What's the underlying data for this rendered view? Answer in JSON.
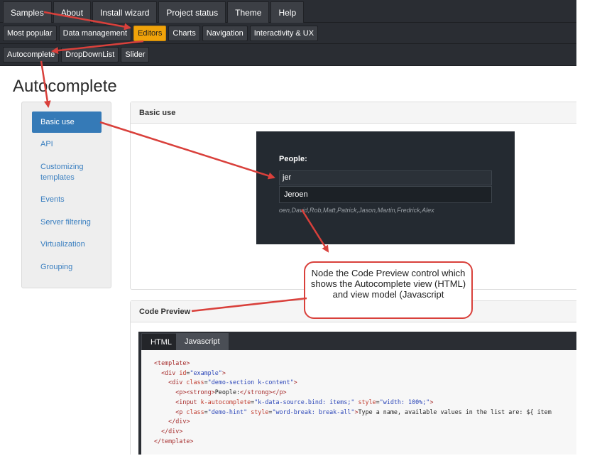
{
  "top_nav": [
    "Samples",
    "About",
    "Install wizard",
    "Project status",
    "Theme",
    "Help"
  ],
  "category_nav": [
    {
      "label": "Most popular",
      "active": false
    },
    {
      "label": "Data management",
      "active": false
    },
    {
      "label": "Editors",
      "active": true
    },
    {
      "label": "Charts",
      "active": false
    },
    {
      "label": "Navigation",
      "active": false
    },
    {
      "label": "Interactivity & UX",
      "active": false
    }
  ],
  "sub_nav": [
    "Autocomplete",
    "DropDownList",
    "Slider"
  ],
  "page_title": "Autocomplete",
  "sidebar": {
    "items": [
      {
        "label": "Basic use",
        "active": true
      },
      {
        "label": "API",
        "active": false
      },
      {
        "label": "Customizing templates",
        "active": false
      },
      {
        "label": "Events",
        "active": false
      },
      {
        "label": "Server filtering",
        "active": false
      },
      {
        "label": "Virtualization",
        "active": false
      },
      {
        "label": "Grouping",
        "active": false
      }
    ]
  },
  "basic_panel": {
    "title": "Basic use",
    "people_label": "People:",
    "input_value": "jer",
    "suggestion": "Jeroen",
    "hint": "oen,David,Rob,Matt,Patrick,Jason,Martin,Fredrick,Alex"
  },
  "code_panel": {
    "title": "Code Preview",
    "tabs": [
      "HTML",
      "Javascript"
    ],
    "active_tab": "HTML"
  },
  "callout_text": "Node the Code Preview control which shows the Autocomplete view (HTML) and view model (Javascript",
  "colors": {
    "nav_bg": "#2a2d33",
    "active_accent": "#f0a30a",
    "sidebar_active": "#357ab7",
    "annotation_red": "#d9403b"
  }
}
